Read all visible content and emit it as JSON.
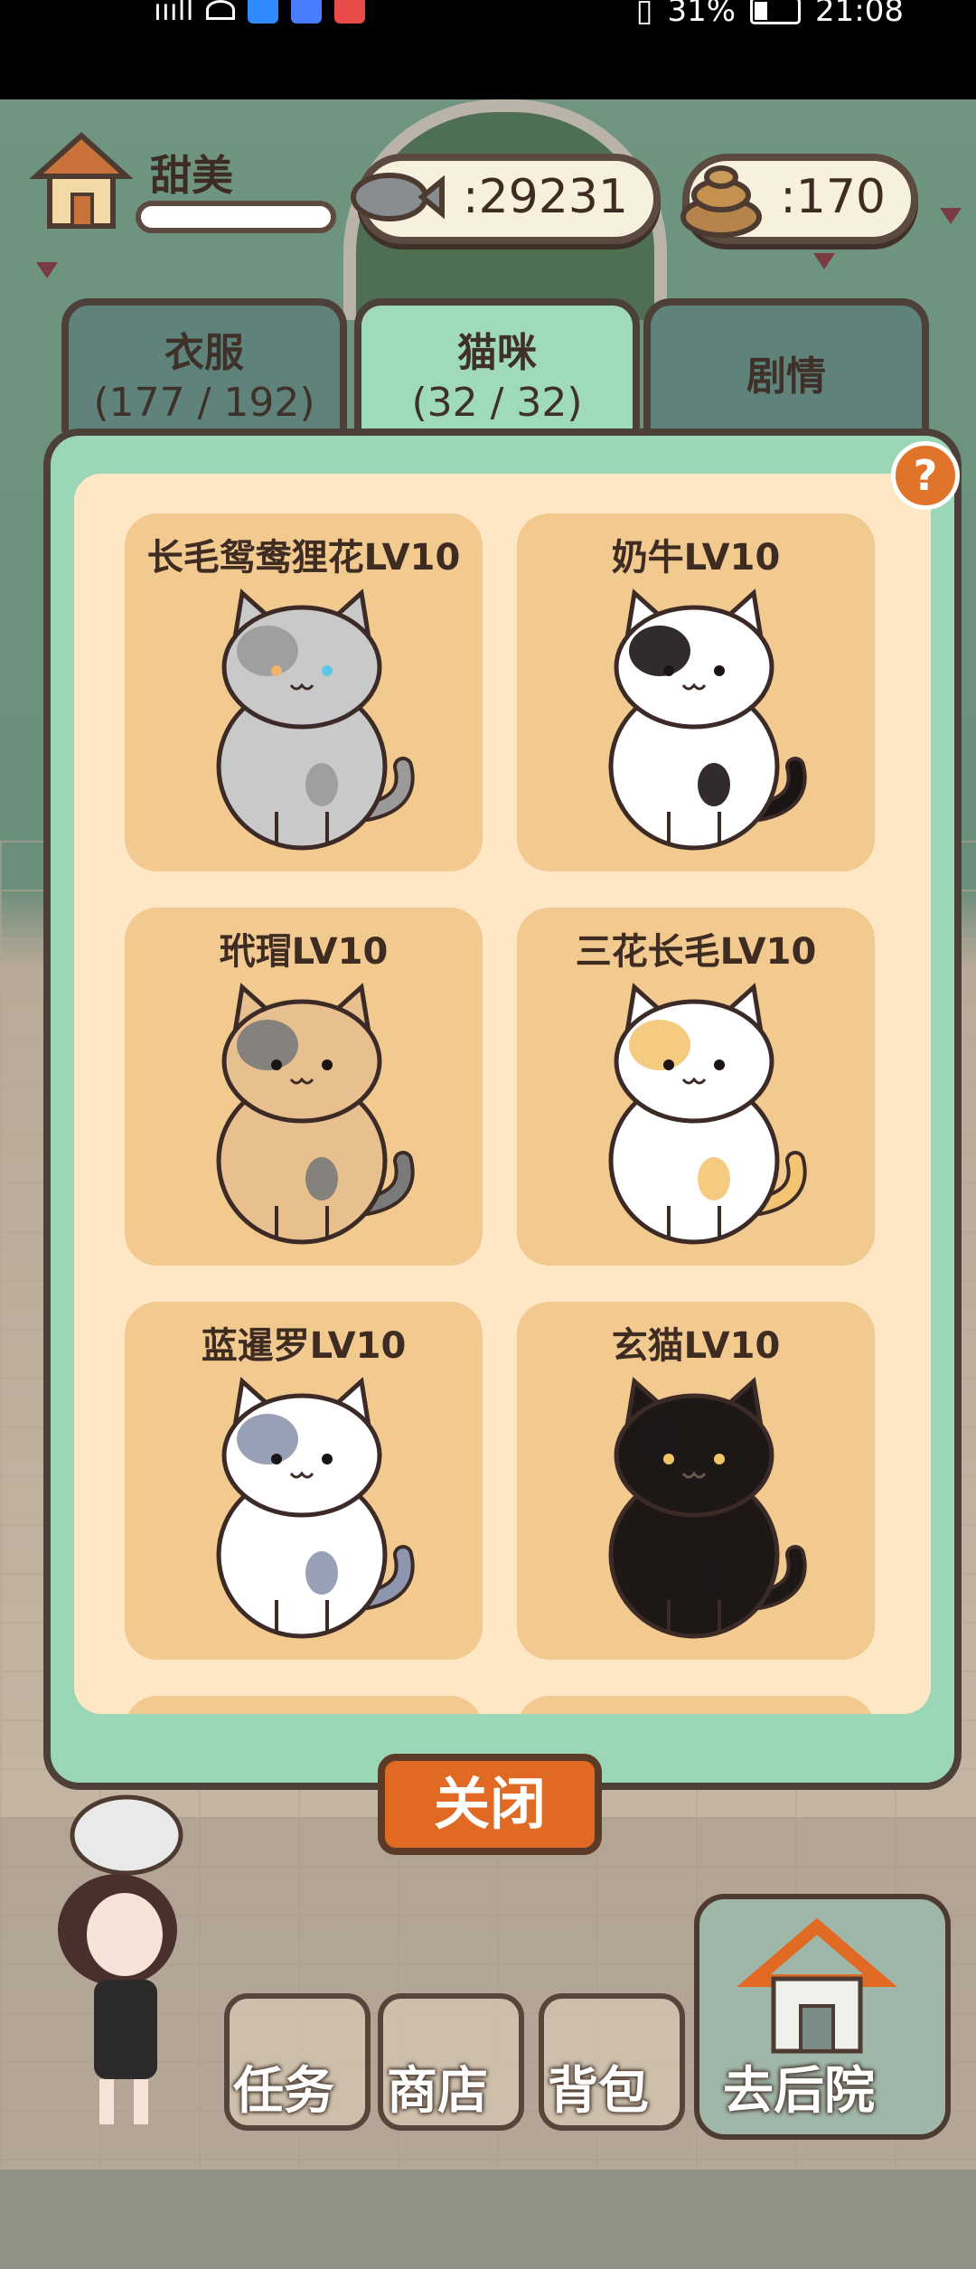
{
  "status_bar": {
    "signal": "ıııll",
    "battery_percent": "31%",
    "time": "21:08"
  },
  "hud": {
    "player_name": "甜美",
    "fish_count": "29231",
    "fish_prefix": ":",
    "poop_count": "170",
    "poop_prefix": ":"
  },
  "tabs": [
    {
      "label": "衣服",
      "count": "(177 / 192)",
      "active": false
    },
    {
      "label": "猫咪",
      "count": "(32 / 32)",
      "active": true
    },
    {
      "label": "剧情",
      "count": "",
      "active": false
    }
  ],
  "help_label": "?",
  "cats": [
    {
      "name": "长毛鸳鸯狸花LV10",
      "fur": "#c9c9c9",
      "patch": "#9a9a9a",
      "eyes": [
        "#f2b36a",
        "#5fc6e8"
      ]
    },
    {
      "name": "奶牛LV10",
      "fur": "#ffffff",
      "patch": "#1b1414",
      "eyes": [
        "#1b1414",
        "#1b1414"
      ]
    },
    {
      "name": "玳瑁LV10",
      "fur": "#e8bf8e",
      "patch": "#7a7a7a",
      "eyes": [
        "#1b1414",
        "#1b1414"
      ]
    },
    {
      "name": "三花长毛LV10",
      "fur": "#ffffff",
      "patch": "#f3c572",
      "eyes": [
        "#1b1414",
        "#1b1414"
      ]
    },
    {
      "name": "蓝暹罗LV10",
      "fur": "#ffffff",
      "patch": "#8d96ad",
      "eyes": [
        "#1b1414",
        "#1b1414"
      ]
    },
    {
      "name": "玄猫LV10",
      "fur": "#1d1716",
      "patch": "#1d1716",
      "eyes": [
        "#f2c463",
        "#f2c463"
      ]
    }
  ],
  "close_label": "关闭",
  "nav": {
    "tasks": "任务",
    "shop": "商店",
    "bag": "背包",
    "backyard": "去后院"
  },
  "colors": {
    "panel_green": "#9bd7b7",
    "panel_cream": "#fde7c4",
    "card_tan": "#f2c98f",
    "accent_orange": "#e06a23",
    "outline_brown": "#4d4039"
  }
}
